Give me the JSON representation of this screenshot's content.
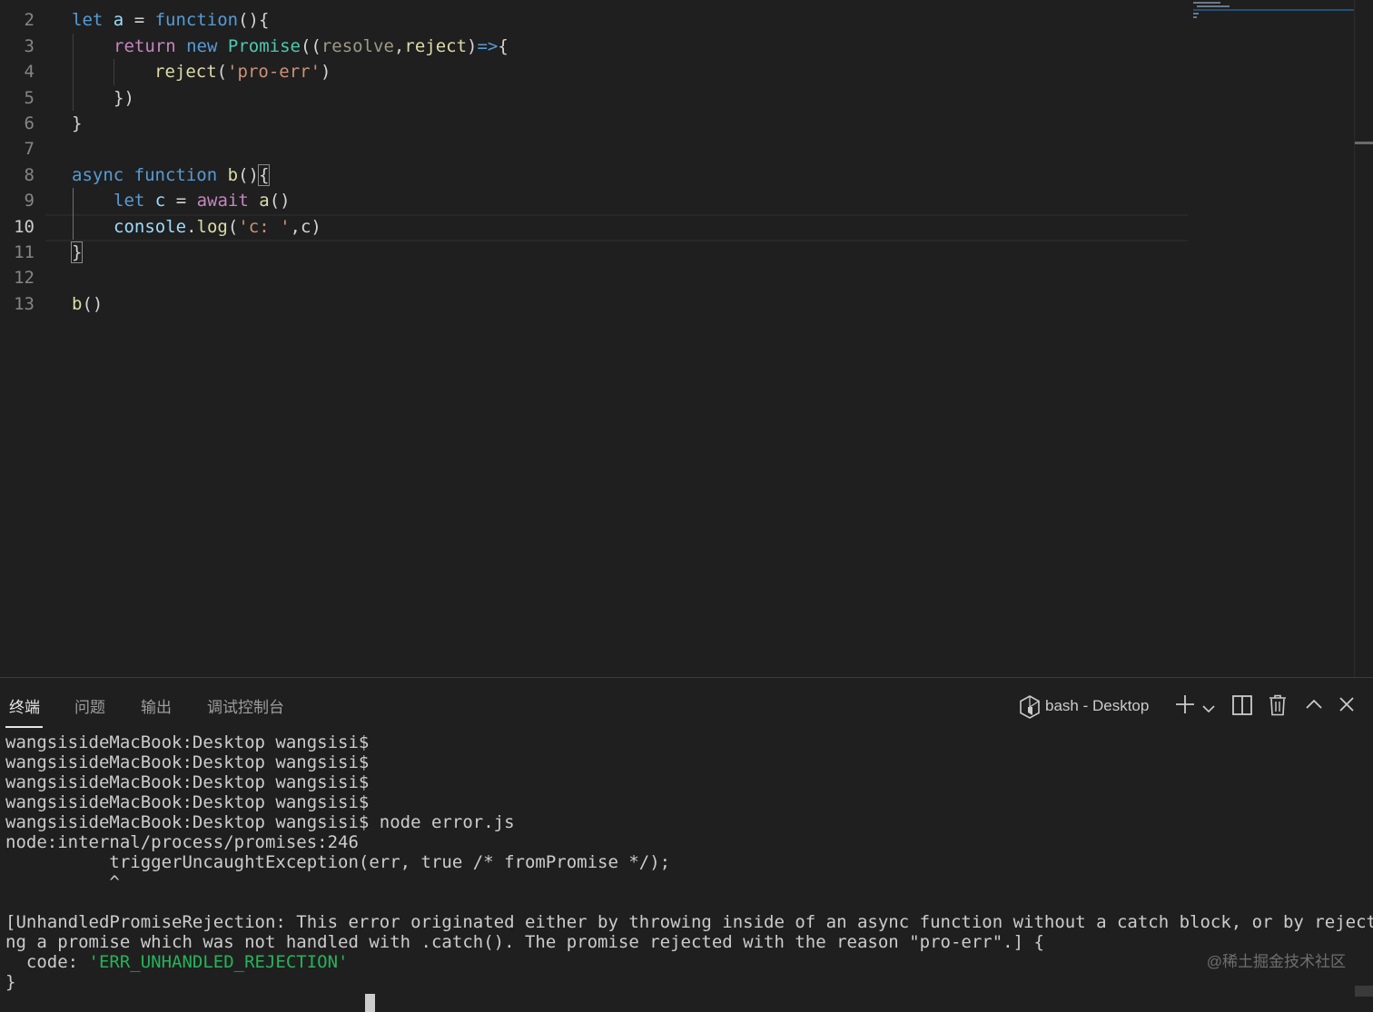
{
  "editor": {
    "gutter": [
      "2",
      "3",
      "4",
      "5",
      "6",
      "7",
      "8",
      "9",
      "10",
      "11",
      "12",
      "13"
    ],
    "active_line": "10",
    "code": {
      "l2": {
        "a": "let",
        "b": "a",
        "c": "=",
        "d": "function",
        "e": "(){"
      },
      "l3": {
        "a": "return",
        "b": "new",
        "c": "Promise",
        "d": "((",
        "e": "resolve",
        "f": ",",
        "g": "reject",
        "h": ")",
        "i": "=>",
        "j": "{"
      },
      "l4": {
        "a": "reject",
        "b": "(",
        "c": "'pro-err'",
        "d": ")"
      },
      "l5": {
        "a": "})"
      },
      "l6": {
        "a": "}"
      },
      "l8": {
        "a": "async",
        "b": "function",
        "c": "b",
        "d": "()",
        "e": "{"
      },
      "l9": {
        "a": "let",
        "b": "c",
        "c": "=",
        "d": "await",
        "e": "a",
        "f": "()"
      },
      "l10": {
        "a": "console",
        "b": ".",
        "c": "log",
        "d": "(",
        "e": "'c: '",
        "f": ",c)"
      },
      "l11": {
        "a": "}"
      },
      "l13": {
        "a": "b",
        "b": "()"
      }
    }
  },
  "panel": {
    "tabs": [
      {
        "label": "终端",
        "active": true
      },
      {
        "label": "问题",
        "active": false
      },
      {
        "label": "输出",
        "active": false
      },
      {
        "label": "调试控制台",
        "active": false
      }
    ],
    "terminal_name": "bash - Desktop",
    "icons": {
      "shell": "terminal-shell-icon",
      "add": "plus-icon",
      "dropdown": "chevron-down-icon",
      "split": "split-icon",
      "kill": "trash-icon",
      "maximize": "chevron-up-icon",
      "close": "close-icon"
    },
    "terminal_lines": [
      "wangsisideMacBook:Desktop wangsisi$",
      "wangsisideMacBook:Desktop wangsisi$",
      "wangsisideMacBook:Desktop wangsisi$",
      "wangsisideMacBook:Desktop wangsisi$",
      "wangsisideMacBook:Desktop wangsisi$ node error.js",
      "node:internal/process/promises:246",
      "          triggerUncaughtException(err, true /* fromPromise */);",
      "          ^",
      "",
      "[UnhandledPromiseRejection: This error originated either by throwing inside of an async function without a catch block, or by rejecti",
      "ng a promise which was not handled with .catch(). The promise rejected with the reason \"pro-err\".] {"
    ],
    "code_key": "  code: ",
    "code_value": "'ERR_UNHANDLED_REJECTION'",
    "closing_brace": "}",
    "watermark": "@稀土掘金技术社区"
  },
  "colors": {
    "background": "#1f1f1f",
    "keyword": "#569cd6",
    "control_keyword": "#c586c0",
    "function": "#dcdcaa",
    "class": "#4ec9b0",
    "string": "#ce9178",
    "terminal_string": "#26b35a"
  }
}
